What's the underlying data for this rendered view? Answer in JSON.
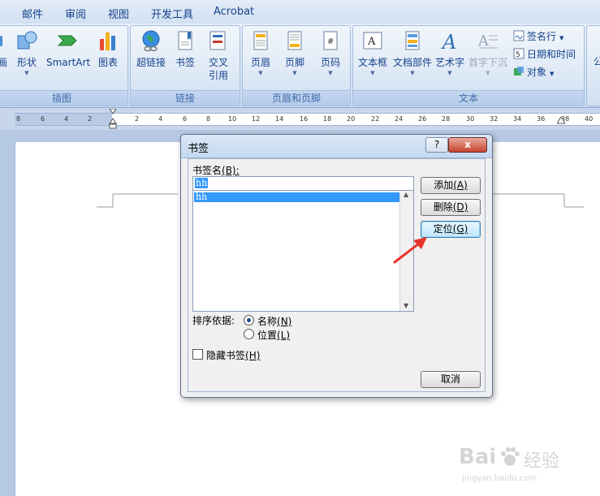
{
  "menu_tabs": [
    "邮件",
    "审阅",
    "视图",
    "开发工具",
    "Acrobat"
  ],
  "ribbon": {
    "illustrations": {
      "label": "插图",
      "buttons": [
        {
          "label": "画",
          "icon": "picture-icon"
        },
        {
          "label": "形状",
          "icon": "shapes-icon"
        },
        {
          "label": "SmartArt",
          "icon": "smartart-icon"
        },
        {
          "label": "图表",
          "icon": "chart-icon"
        }
      ]
    },
    "links": {
      "label": "链接",
      "buttons": [
        {
          "label": "超链接",
          "icon": "hyperlink-globe-icon"
        },
        {
          "label": "书签",
          "icon": "bookmark-icon"
        },
        {
          "label": "交叉\n引用",
          "label_line1": "交叉",
          "label_line2": "引用",
          "icon": "cross-reference-icon"
        }
      ]
    },
    "header_footer": {
      "label": "页眉和页脚",
      "buttons": [
        {
          "label": "页眉",
          "icon": "header-icon"
        },
        {
          "label": "页脚",
          "icon": "footer-icon"
        },
        {
          "label": "页码",
          "icon": "page-number-icon"
        }
      ]
    },
    "text": {
      "label": "文本",
      "buttons": [
        {
          "label": "文本框",
          "icon": "textbox-icon"
        },
        {
          "label": "文档部件",
          "icon": "quick-parts-icon"
        },
        {
          "label": "艺术字",
          "icon": "wordart-icon"
        },
        {
          "label": "首字下沉",
          "icon": "drop-cap-icon"
        }
      ],
      "small_buttons": [
        {
          "label": "签名行",
          "icon": "signature-line-icon"
        },
        {
          "label": "日期和时间",
          "icon": "date-time-icon"
        },
        {
          "label": "对象",
          "icon": "object-icon"
        }
      ]
    },
    "extra_label": "公"
  },
  "ruler_ticks": [
    "8",
    "6",
    "4",
    "2",
    "2",
    "4",
    "6",
    "8",
    "10",
    "12",
    "14",
    "16",
    "18",
    "20",
    "22",
    "24",
    "26",
    "28",
    "30",
    "32",
    "34",
    "36",
    "38",
    "40"
  ],
  "dialog": {
    "title": "书签",
    "help_label": "?",
    "close_label": "x",
    "name_label": "书签名",
    "name_label_key": "(B):",
    "name_value": "hh",
    "list_items": [
      "hh"
    ],
    "add_label": "添加",
    "add_key": "(A)",
    "delete_label": "删除",
    "delete_key": "(D)",
    "goto_label": "定位",
    "goto_key": "(G)",
    "sort_label": "排序依据:",
    "sort_options": [
      {
        "label": "名称",
        "key": "(N)",
        "selected": true
      },
      {
        "label": "位置",
        "key": "(L)",
        "selected": false
      }
    ],
    "hidden_label": "隐藏书签",
    "hidden_key": "(H)",
    "hidden_checked": false,
    "cancel_label": "取消"
  },
  "watermark": {
    "brand": "Bai",
    "brand2": "经验",
    "url": "jingyan.baidu.com"
  },
  "colors": {
    "accent_blue": "#15428b",
    "selection_blue": "#3399ff",
    "arrow_red": "#e8332a"
  }
}
